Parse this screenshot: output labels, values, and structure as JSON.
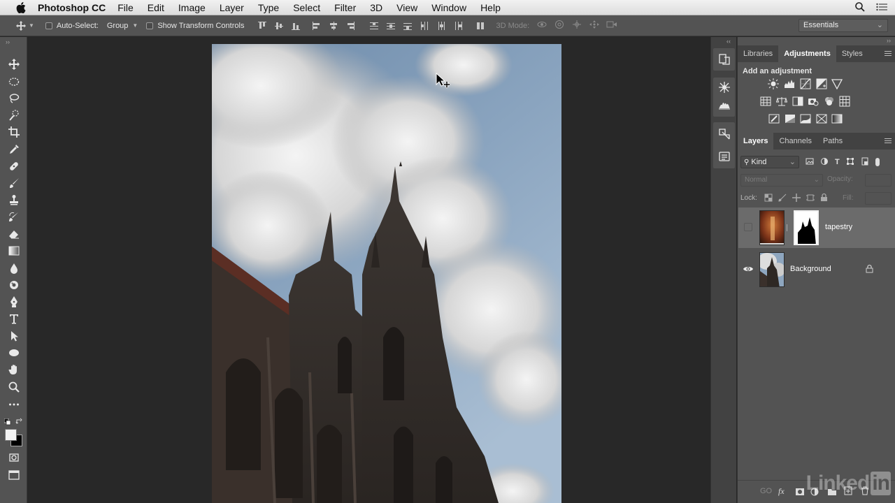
{
  "menubar": {
    "app_name": "Photoshop CC",
    "items": [
      "File",
      "Edit",
      "Image",
      "Layer",
      "Type",
      "Select",
      "Filter",
      "3D",
      "View",
      "Window",
      "Help"
    ]
  },
  "options": {
    "auto_select_label": "Auto-Select:",
    "auto_select_value": "Group",
    "show_transform_label": "Show Transform Controls",
    "mode_3d_label": "3D Mode:",
    "workspace_value": "Essentials"
  },
  "adjustments_panel": {
    "tabs": [
      "Libraries",
      "Adjustments",
      "Styles"
    ],
    "active_tab": "Adjustments",
    "title": "Add an adjustment"
  },
  "layers_panel": {
    "tabs": [
      "Layers",
      "Channels",
      "Paths"
    ],
    "active_tab": "Layers",
    "filter_kind": "Kind",
    "blend_mode": "Normal",
    "opacity_label": "Opacity:",
    "lock_label": "Lock:",
    "fill_label": "Fill:",
    "layers": [
      {
        "name": "tapestry",
        "visible": false,
        "selected": true,
        "has_mask": true
      },
      {
        "name": "Background",
        "visible": true,
        "selected": false,
        "locked": true
      }
    ]
  },
  "watermark": "Linked in",
  "colors": {
    "panel_bg": "#535353",
    "workspace_bg": "#282828",
    "selected_layer": "#6b6b6b"
  }
}
